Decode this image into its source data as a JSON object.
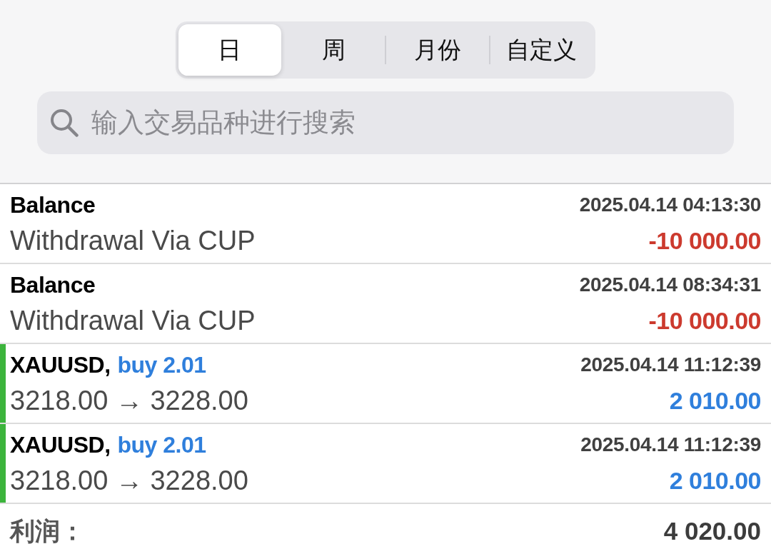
{
  "segments": [
    {
      "label": "日",
      "selected": true
    },
    {
      "label": "周",
      "selected": false
    },
    {
      "label": "月份",
      "selected": false
    },
    {
      "label": "自定义",
      "selected": false
    }
  ],
  "search": {
    "placeholder": "输入交易品种进行搜索"
  },
  "history": [
    {
      "kind": "balance",
      "type": "Balance",
      "time": "2025.04.14 04:13:30",
      "comment": "Withdrawal Via CUP",
      "amount": "-10 000.00"
    },
    {
      "kind": "balance",
      "type": "Balance",
      "time": "2025.04.14 08:34:31",
      "comment": "Withdrawal Via CUP",
      "amount": "-10 000.00"
    },
    {
      "kind": "trade",
      "color": "#3cb43c",
      "symbol": "XAUUSD,",
      "order": "buy 2.01",
      "time": "2025.04.14 11:12:39",
      "prices": "3218.00 → 3228.00",
      "amount": "2 010.00"
    },
    {
      "kind": "trade",
      "color": "#3cb43c",
      "symbol": "XAUUSD,",
      "order": "buy 2.01",
      "time": "2025.04.14 11:12:39",
      "prices": "3218.00 → 3228.00",
      "amount": "2 010.00"
    }
  ],
  "summary": {
    "label": "利润：",
    "value": "4 020.00"
  }
}
